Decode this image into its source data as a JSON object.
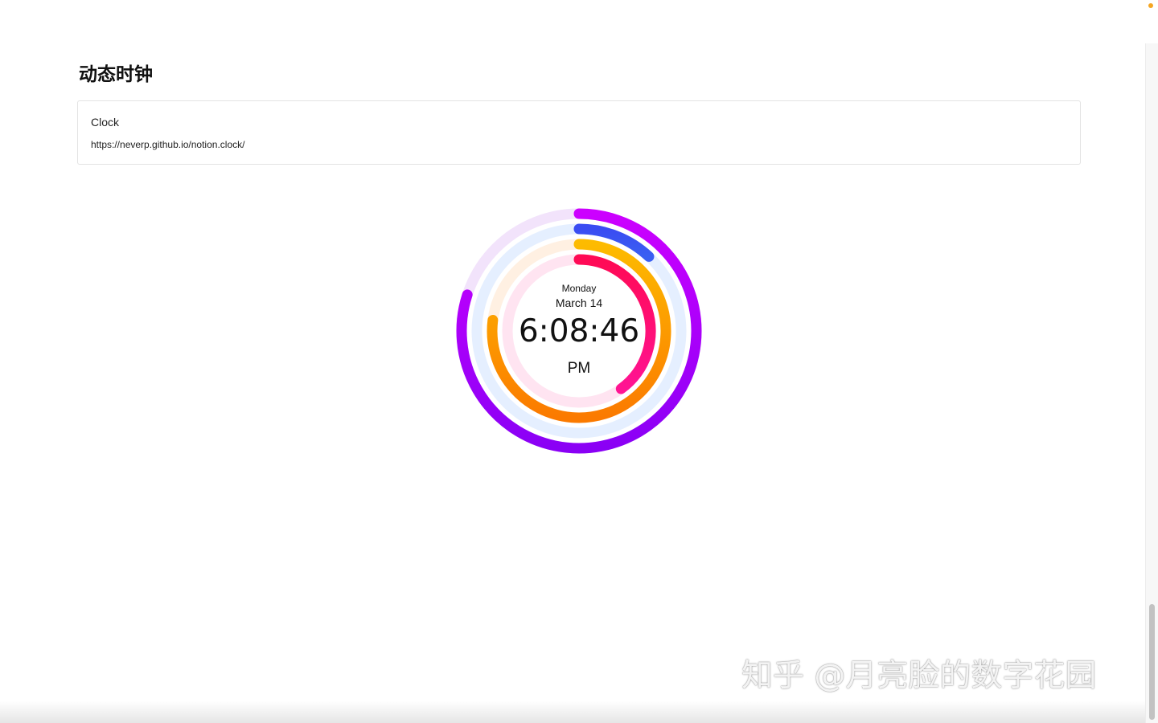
{
  "page": {
    "heading": "动态时钟"
  },
  "bookmark": {
    "title": "Clock",
    "url": "https://neverp.github.io/notion.clock/"
  },
  "clock": {
    "day": "Monday",
    "date": "March 14",
    "time": "6:08:46",
    "period": "PM",
    "rings": [
      {
        "name": "month",
        "fraction": 0.8,
        "colors": [
          "#cc00ff",
          "#8a00f5"
        ],
        "track": "#f2e3fb"
      },
      {
        "name": "day",
        "fraction": 0.12,
        "colors": [
          "#3a4cf2",
          "#3a5ff2"
        ],
        "track": "#e5efff"
      },
      {
        "name": "hour",
        "fraction": 0.77,
        "colors": [
          "#fdbb00",
          "#fb7a00"
        ],
        "track": "#fff0e2"
      },
      {
        "name": "minute",
        "fraction": 0.4,
        "colors": [
          "#ff0a55",
          "#ff1493"
        ],
        "track": "#ffe4f1"
      }
    ]
  },
  "watermark": {
    "text": "知乎 @月亮脸的数字花园"
  }
}
